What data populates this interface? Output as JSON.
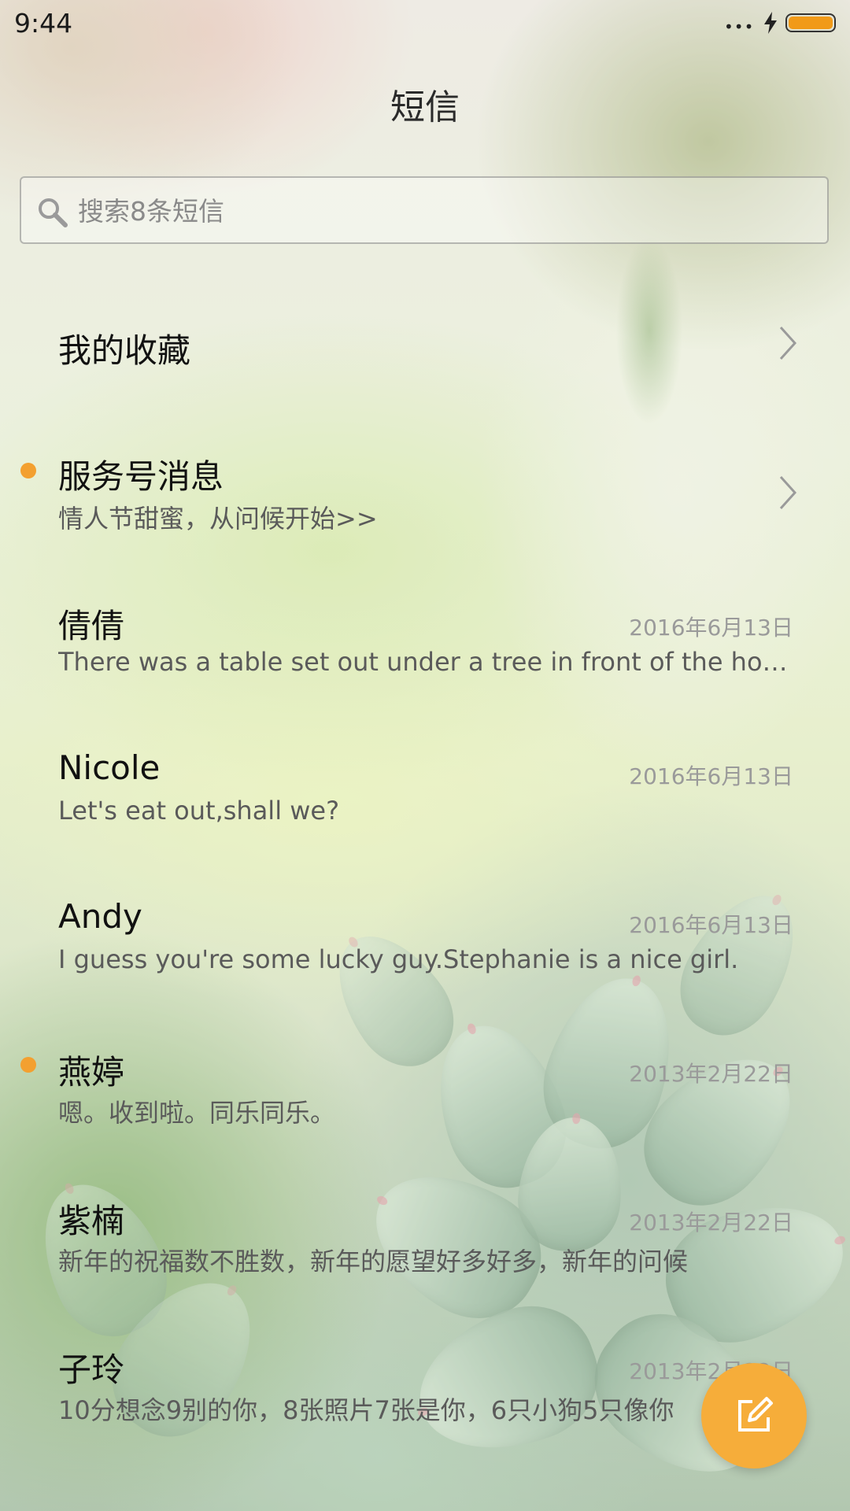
{
  "status_bar": {
    "time": "9:44",
    "signal": "•••"
  },
  "header": {
    "title": "短信"
  },
  "search": {
    "placeholder": "搜索8条短信"
  },
  "favorites": {
    "label": "我的收藏"
  },
  "service": {
    "title": "服务号消息",
    "subtitle": "情人节甜蜜，从问候开始>>",
    "unread": true
  },
  "conversations": [
    {
      "name": "倩倩",
      "date": "2016年6月13日",
      "preview": "There was a table set out under a tree in front of the house",
      "unread": false
    },
    {
      "name": "Nicole",
      "date": "2016年6月13日",
      "preview": "Let's eat out,shall we?",
      "unread": false
    },
    {
      "name": "Andy",
      "date": "2016年6月13日",
      "preview": "I guess you're some lucky guy.Stephanie is a nice girl.",
      "unread": false
    },
    {
      "name": "燕婷",
      "date": "2013年2月22日",
      "preview": "嗯。收到啦。同乐同乐。",
      "unread": true
    },
    {
      "name": "紫楠",
      "date": "2013年2月22日",
      "preview": "新年的祝福数不胜数，新年的愿望好多好多，新年的问候",
      "unread": false
    },
    {
      "name": "子玲",
      "date": "2013年2月22日",
      "preview": "10分想念9别的你，8张照片7张是你，6只小狗5只像你",
      "unread": false
    }
  ],
  "colors": {
    "accent": "#f6ad3a",
    "unread_dot": "#f3a030",
    "battery": "#f19a18"
  },
  "icons": {
    "search": "search-icon",
    "chevron": "chevron-right-icon",
    "compose": "compose-icon"
  }
}
